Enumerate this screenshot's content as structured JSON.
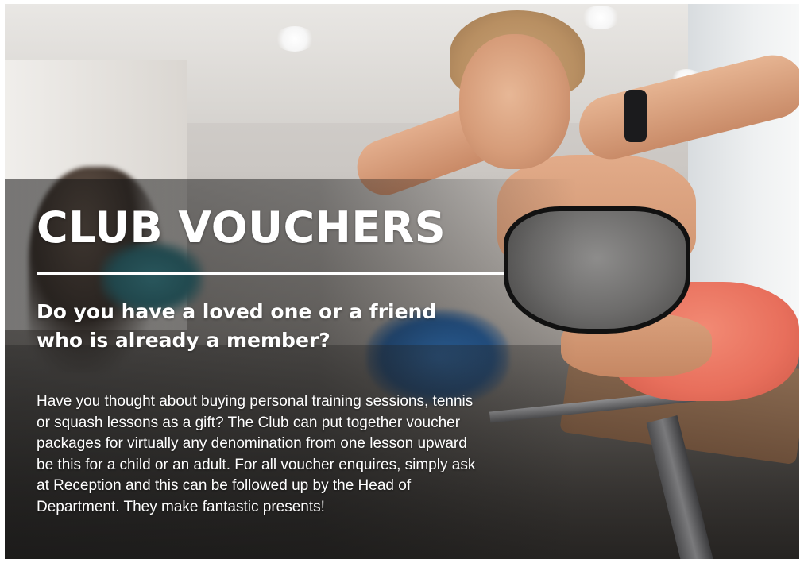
{
  "hero": {
    "title": "CLUB VOUCHERS",
    "subtitle_lines": [
      "Do you have a loved one or a friend",
      "who is already a member?"
    ],
    "body_lines": [
      "Have you thought about buying personal training sessions, tennis",
      "or squash lessons as a gift? The Club can put together voucher",
      "packages for virtually any denomination from one lesson upward",
      "be this for a child or an adult. For all voucher enquires, simply ask",
      "at Reception and this can be followed up by the Head of",
      "Department. They make fantastic presents!"
    ]
  },
  "colors": {
    "text": "#ffffff",
    "rule": "#ffffff",
    "shorts": "#e86f5c",
    "top": "#6d6c6b"
  }
}
